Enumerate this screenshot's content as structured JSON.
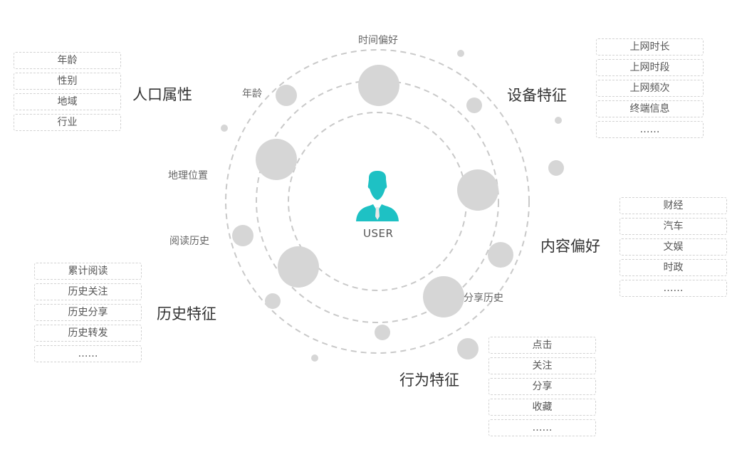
{
  "center": {
    "label": "USER",
    "icon": "user-icon",
    "icon_color": "#1ec1c4"
  },
  "colors": {
    "orbit": "#c9c9c9",
    "node": "#d6d6d6",
    "box_border": "#d2d2d2"
  },
  "orbit_labels": {
    "time_pref": "时间偏好",
    "age": "年龄",
    "geo": "地理位置",
    "reading": "阅读历史",
    "share": "分享历史"
  },
  "categories": {
    "demographic": {
      "title": "人口属性",
      "items": [
        "年龄",
        "性别",
        "地域",
        "行业"
      ]
    },
    "device": {
      "title": "设备特征",
      "items": [
        "上网时长",
        "上网时段",
        "上网频次",
        "终端信息",
        "……"
      ]
    },
    "content": {
      "title": "内容偏好",
      "items": [
        "财经",
        "汽车",
        "文娱",
        "时政",
        "……"
      ]
    },
    "history": {
      "title": "历史特征",
      "items": [
        "累计阅读",
        "历史关注",
        "历史分享",
        "历史转发",
        "……"
      ]
    },
    "behavior": {
      "title": "行为特征",
      "items": [
        "点击",
        "关注",
        "分享",
        "收藏",
        "……"
      ]
    }
  }
}
